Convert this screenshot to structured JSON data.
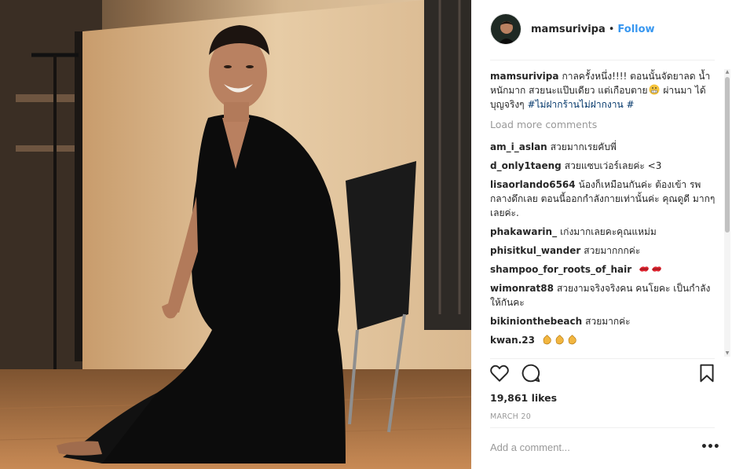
{
  "post": {
    "username": "mamsurivipa",
    "separator": "•",
    "follow_label": "Follow",
    "likes": "19,861 likes",
    "date": "MARCH 20",
    "add_comment_placeholder": "Add a comment...",
    "more_label": "•••"
  },
  "caption": {
    "username": "mamsurivipa",
    "text_before_emoji": "กาลครั้งหนึ่ง!!!! ตอนนั้นจัดยาลด น้ำหนักมาก สวยนะแป๊บเดียว แต่เกือบตาย",
    "emoji": "grimace-emoji",
    "text_after_emoji": " ผ่านมา ได้ บุญจริงๆ ",
    "hashtag": "#ไม่ฝากร้านไม่ฝากงาน",
    "suffix": " #"
  },
  "load_more": "Load more comments",
  "comments": [
    {
      "user": "am_i_aslan",
      "text": "สวยมากเรยคับพี่"
    },
    {
      "user": "d_only1taeng",
      "text": "สวยแซบเว่อร์เลยค่ะ <3"
    },
    {
      "user": "lisaorlando6564",
      "text": "น้องก็เหมือนกันค่ะ ต้องเข้า รพ กลางดึกเลย ตอนนี้ออกกำลังกายเท่านั้นค่ะ คุณดูดี มากๆเลยค่ะ."
    },
    {
      "user": "phakawarin_",
      "text": "เก่งมากเลยคะคุณแหม่ม"
    },
    {
      "user": "phisitkul_wander",
      "text": "สวยมากกกค่ะ"
    },
    {
      "user": "shampoo_for_roots_of_hair",
      "text": "",
      "emojis": [
        "kiss-emoji",
        "kiss-emoji"
      ]
    },
    {
      "user": "wimonrat88",
      "text": "สวยงามจริงจริงคน คนโยคะ เป็นกำลัง ให้กันคะ"
    },
    {
      "user": "bikinionthebeach",
      "text": "สวยมากค่ะ"
    },
    {
      "user": "kwan.23",
      "text": "",
      "emojis": [
        "clap-emoji",
        "clap-emoji",
        "clap-emoji"
      ]
    }
  ],
  "icons": {
    "like": "heart-icon",
    "comment": "speech-bubble-icon",
    "save": "bookmark-icon"
  },
  "colors": {
    "accent": "#3897f0",
    "hashtag": "#003569",
    "muted": "#999999",
    "divider": "#efefef"
  }
}
